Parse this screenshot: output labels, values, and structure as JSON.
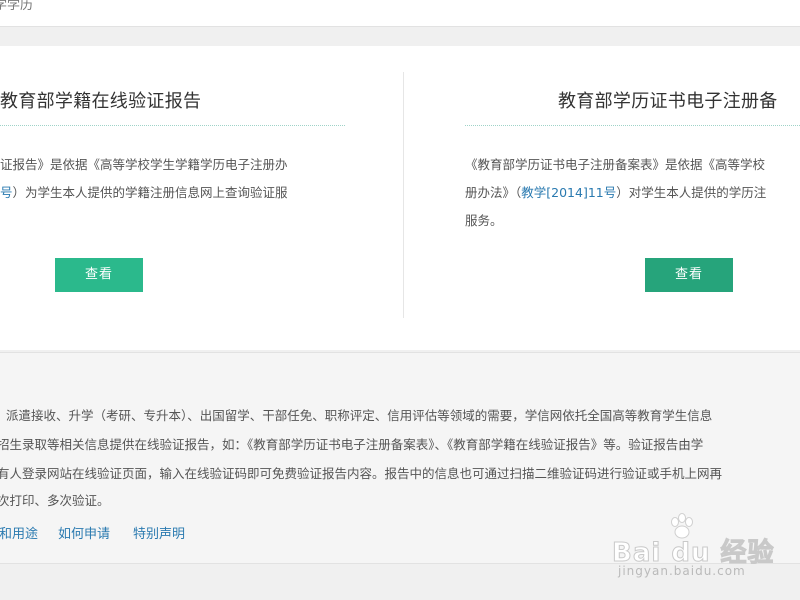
{
  "header": {
    "breadcrumb": "学学历"
  },
  "cards": [
    {
      "title": "教育部学籍在线验证报告",
      "desc_line1": "证报告》是依据《高等学校学生学籍学历电子注册办",
      "desc_line2_link": "号",
      "desc_line2_rest": "）为学生本人提供的学籍注册信息网上查询验证服",
      "button": "查看"
    },
    {
      "title": "教育部学历证书电子注册备",
      "desc_line1": "《教育部学历证书电子注册备案表》是依据《高等学校",
      "desc_line2_pre": "册办法》（",
      "desc_line2_link": "教学[2014]11号",
      "desc_line2_rest": "）对学生本人提供的学历注",
      "desc_line3": "服务。",
      "button": "查看"
    }
  ],
  "info": {
    "lines": [
      "派遣接收、升学（考研、专升本）、出国留学、干部任免、职称评定、信用评估等领域的需要，学信网依托全国高等教育学生信息",
      "招生录取等相关信息提供在线验证报告，如：《教育部学历证书电子注册备案表》、《教育部学籍在线验证报告》等。验证报告由学",
      "有人登录网站在线验证页面，输入在线验证码即可免费验证报告内容。报告中的信息也可通过扫描二维验证码进行验证或手机上网再",
      "次打印、多次验证。"
    ],
    "links": [
      "和用途",
      "如何申请",
      "特别声明"
    ]
  },
  "watermark": {
    "main": "Bai du 经验",
    "sub": "jingyan.baidu.com"
  },
  "colors": {
    "accent_green": "#2bb98c",
    "accent_green_dark": "#26a47b",
    "link_blue": "#2a7ab0"
  }
}
